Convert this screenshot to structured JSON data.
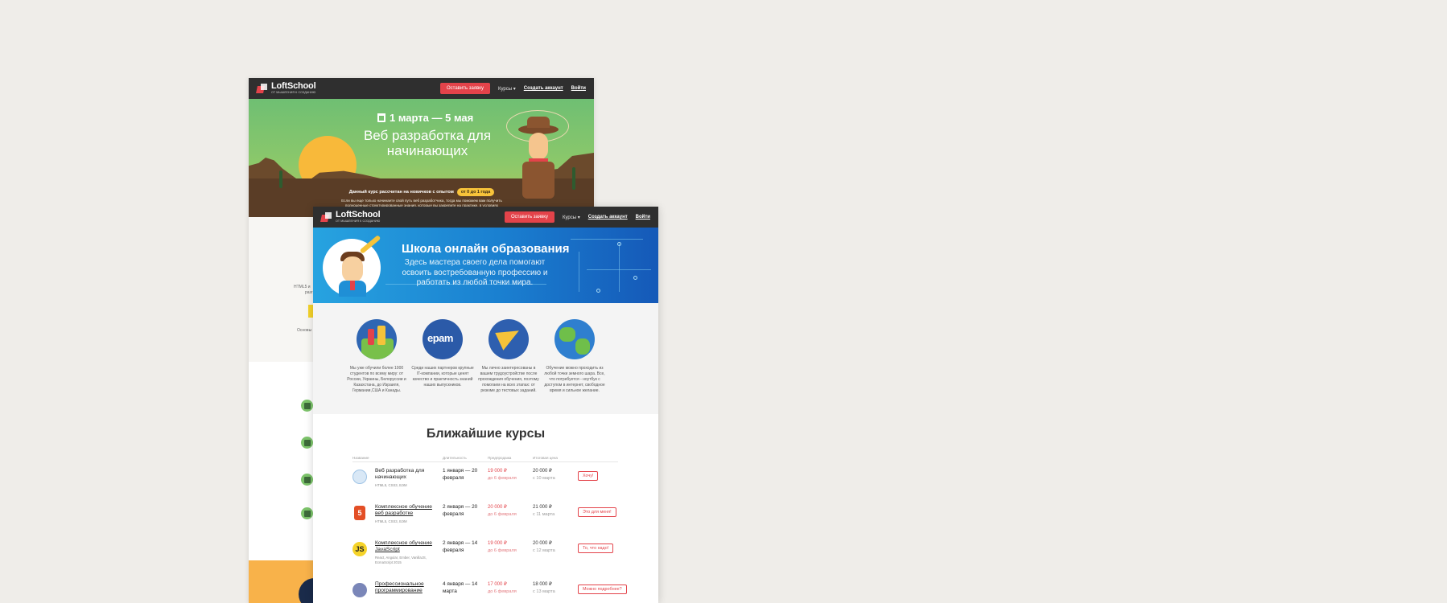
{
  "back_page": {
    "logo": {
      "name": "LoftSchool",
      "tagline": "от мышления к созданию"
    },
    "nav": {
      "apply": "Оставить заявку",
      "courses": "Курсы ▾",
      "register": "Создать аккаунт",
      "login": "Войти"
    },
    "hero": {
      "date": "1 марта — 5 мая",
      "title": "Веб разработка для начинающих",
      "note": "Данный курс рассчитан на новичков с опытом",
      "pill": "от 0 до 1 года",
      "description": "Если вы еще только начинаете свой путь веб разработчика, тогда мы поможем вам получить полноценные структурированные знания, которые вы закрепите на практике, в условиях максимально приближенных к разработке в реальной веб студии."
    },
    "fragments": {
      "f1": "HTML5 и",
      "f2": "разг",
      "f3": "Основы"
    }
  },
  "front_page": {
    "logo": {
      "name": "LoftSchool",
      "tagline": "от мышления к созданию"
    },
    "nav": {
      "apply": "Оставить заявку",
      "courses": "Курсы ▾",
      "register": "Создать аккаунт",
      "login": "Войти"
    },
    "hero": {
      "title": "Школа онлайн образования",
      "subtitle": "Здесь мастера своего дела помогают освоить востребованную профессию и работать из любой точки мира."
    },
    "features": [
      {
        "icon": "city-icon",
        "text": "Мы уже обучили более 1000 студентов по всему миру: от России, Украины, Белоруссии и Казахстана, до Израиля, Германии,США и Канады."
      },
      {
        "icon": "epam-icon",
        "label": "epam",
        "text": "Среди наших партнеров крупные IT-компании, которые ценят качество и практичность знаний наших выпускников."
      },
      {
        "icon": "paper-plane-icon",
        "text": "Мы лично заинтересованы в вашем трудоустройстве после прохождения обучения, поэтому помогаем на всех этапах: от резюме до тестовых заданий."
      },
      {
        "icon": "globe-icon",
        "text": "Обучение можно проходить из любой точки земного шара. Все, что потребуется - ноутбук с доступом в интернет, свободное время и сильное желание."
      }
    ],
    "courses": {
      "heading": "Ближайшие курсы",
      "columns": [
        "Название",
        "Длительность",
        "Предпродажа",
        "Итоговая цена"
      ],
      "rows": [
        {
          "icon": "mascot-icon",
          "icon_label": "",
          "name": "Веб разработка для начинающих",
          "tags": "HTML5, CSS3, БЭМ",
          "duration": "1 января — 20 февраля",
          "presale_price": "19 000 ₽",
          "presale_until": "до 6 февраля",
          "final_price": "20 000 ₽",
          "final_from": "с 10 марта",
          "button": "Хочу!"
        },
        {
          "icon": "html5-icon",
          "icon_label": "5",
          "name": "Комплексное обучение веб разработке",
          "tags": "HTML5, CSS3, БЭМ",
          "duration": "2 января — 20 февраля",
          "presale_price": "20 000 ₽",
          "presale_until": "до 6 февраля",
          "final_price": "21 000 ₽",
          "final_from": "с 11 марта",
          "button": "Это для меня!"
        },
        {
          "icon": "js-icon",
          "icon_label": "JS",
          "name": "Комплексное обучение JavaScript",
          "tags": "React, Angular, Ember, VanillaJS, EcmaScript 2015",
          "duration": "2 января — 14 февраля",
          "presale_price": "19 000 ₽",
          "presale_until": "до 6 февраля",
          "final_price": "20 000 ₽",
          "final_from": "с 12 марта",
          "button": "То, что надо!"
        },
        {
          "icon": "php-icon",
          "icon_label": "",
          "name": "Профессиональное программирование",
          "tags": "",
          "duration": "4 января — 14 марта",
          "presale_price": "17 000 ₽",
          "presale_until": "до 6 февраля",
          "final_price": "18 000 ₽",
          "final_from": "с 13 марта",
          "button": "Можно подробнее?"
        }
      ]
    }
  },
  "colors": {
    "background": "#efede9",
    "nav": "#2f2f2f",
    "accent": "#e3434a",
    "hero_blue": "#1a7fd0",
    "hero_green": "#7fc56d"
  }
}
